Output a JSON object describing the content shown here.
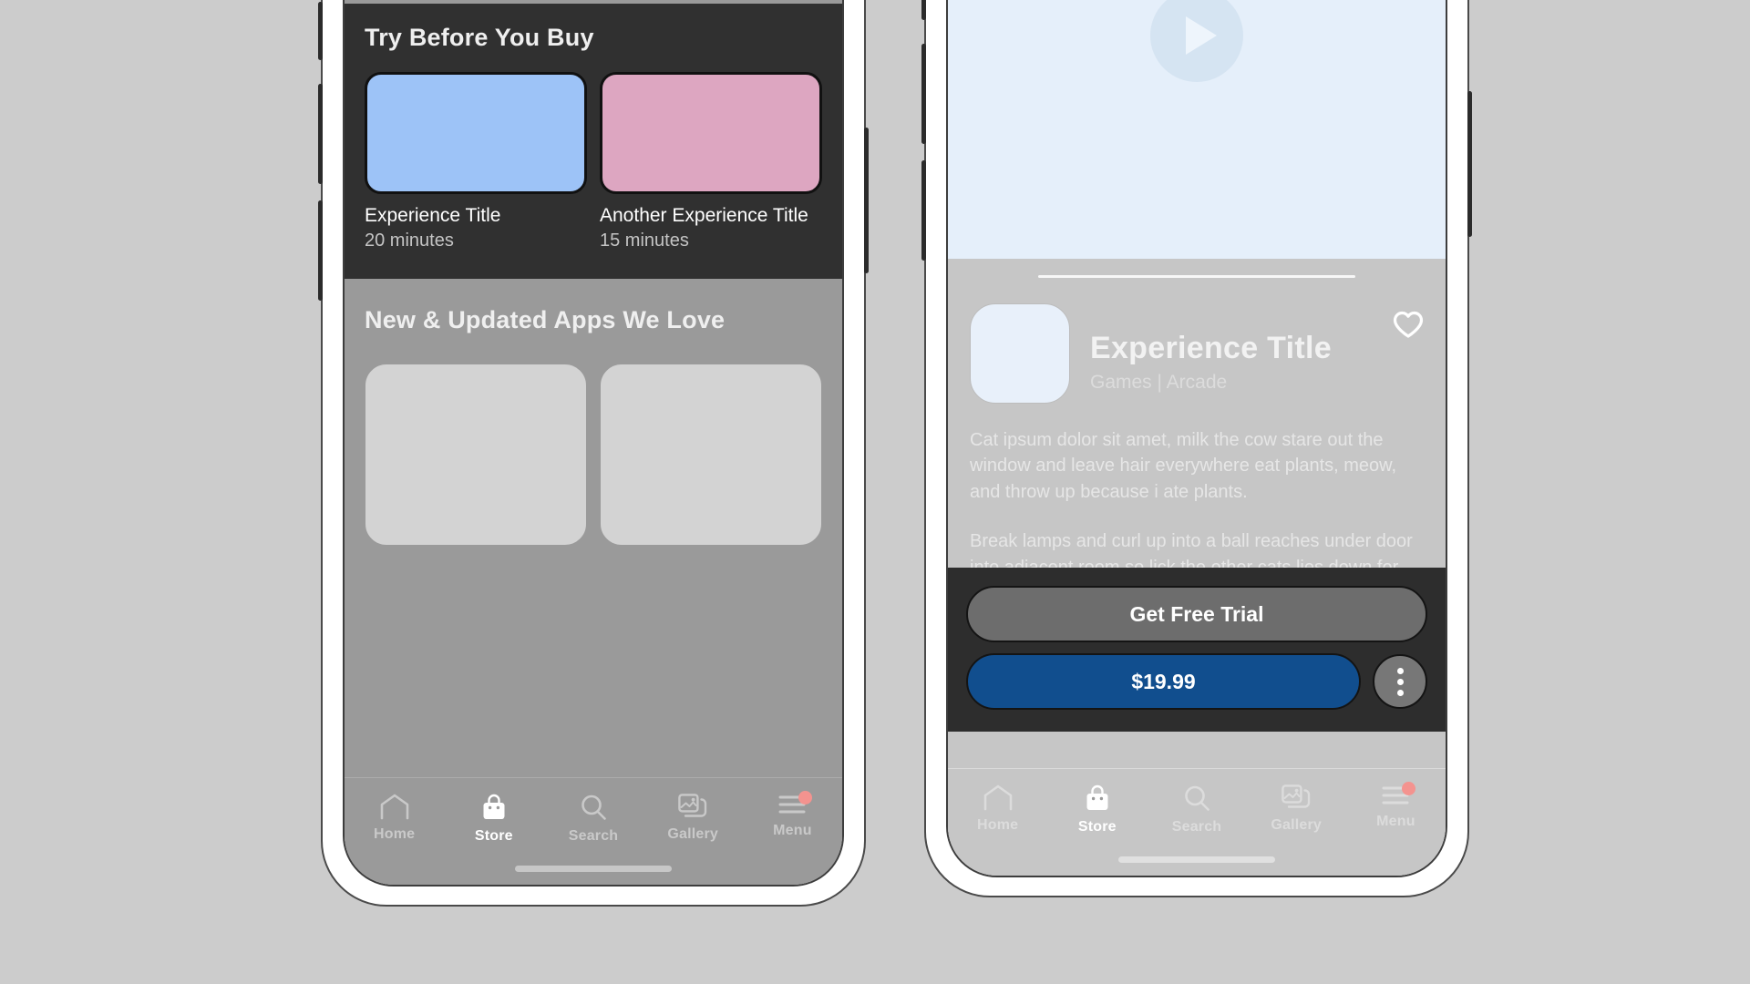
{
  "canvas": {
    "background": "#cccccc"
  },
  "left_phone": {
    "name": "Store browse screen",
    "screen_bg": "#9a9a9a",
    "top_placeholders": [
      {
        "label": "placeholder-card-1"
      },
      {
        "label": "placeholder-card-2"
      }
    ],
    "try_section": {
      "title": "Try Before You Buy",
      "background": "#303030",
      "items": [
        {
          "title": "Experience Title",
          "duration": "20 minutes",
          "thumb_color": "#9dc3f7"
        },
        {
          "title": "Another Experience Title",
          "duration": "15 minutes",
          "thumb_color": "#dda6c1"
        }
      ]
    },
    "new_section": {
      "title": "New & Updated Apps We Love",
      "placeholders": [
        {
          "label": "placeholder-card-3"
        },
        {
          "label": "placeholder-card-4"
        }
      ]
    },
    "tabbar": {
      "items": [
        {
          "label": "Home",
          "icon": "home-icon",
          "active": false,
          "badge": false
        },
        {
          "label": "Store",
          "icon": "store-icon",
          "active": true,
          "badge": false
        },
        {
          "label": "Search",
          "icon": "search-icon",
          "active": false,
          "badge": false
        },
        {
          "label": "Gallery",
          "icon": "gallery-icon",
          "active": false,
          "badge": false
        },
        {
          "label": "Menu",
          "icon": "menu-icon",
          "active": false,
          "badge": true
        }
      ],
      "badge_color": "#f4938f"
    }
  },
  "right_phone": {
    "name": "Experience detail screen",
    "screen_bg": "#c6c6c6",
    "hero": {
      "type": "video-preview",
      "background": "#e5effa",
      "play_button": "play-icon"
    },
    "detail": {
      "icon_color": "#e8f0fa",
      "title": "Experience Title",
      "subtitle": "Games | Arcade",
      "favorite_icon": "heart-icon",
      "paragraph_1": "Cat ipsum dolor sit amet, milk the cow stare out the window and leave hair everywhere eat plants, meow, and throw up because i ate plants.",
      "paragraph_2": "Break lamps and curl up into a ball reaches under door into adjacent room so lick the other cats lies down for being gorgeous with belly side up eat prawns daintily with a claw then lick paws clean wash down prawns with a lap"
    },
    "actions": {
      "background": "#2d2d2d",
      "trial_label": "Get Free Trial",
      "trial_color": "#6d6d6d",
      "price_label": "$19.99",
      "price_color": "#114e8e",
      "more_icon": "more-vertical-icon"
    },
    "tabbar": {
      "items": [
        {
          "label": "Home",
          "icon": "home-icon",
          "active": false,
          "badge": false
        },
        {
          "label": "Store",
          "icon": "store-icon",
          "active": true,
          "badge": false
        },
        {
          "label": "Search",
          "icon": "search-icon",
          "active": false,
          "badge": false
        },
        {
          "label": "Gallery",
          "icon": "gallery-icon",
          "active": false,
          "badge": false
        },
        {
          "label": "Menu",
          "icon": "menu-icon",
          "active": false,
          "badge": true
        }
      ],
      "badge_color": "#f4938f"
    }
  }
}
